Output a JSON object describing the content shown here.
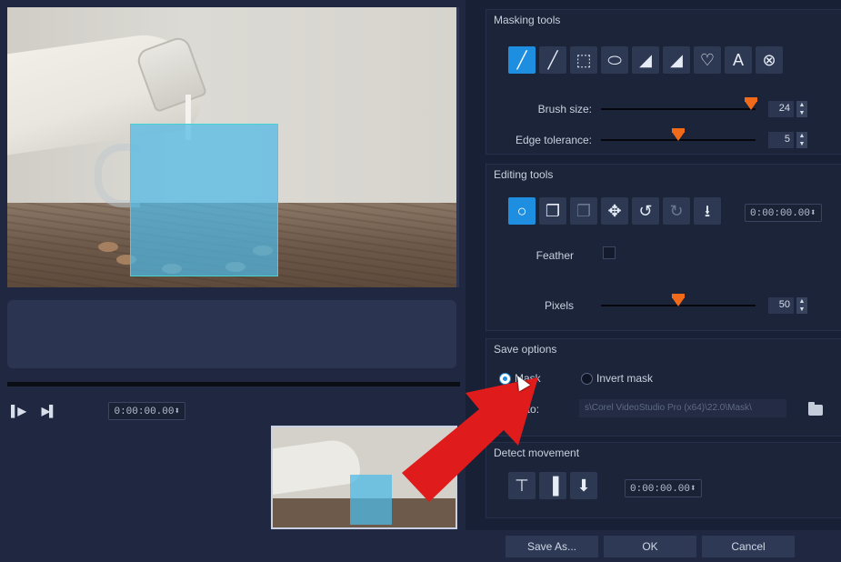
{
  "masking_tools": {
    "title": "Masking tools",
    "tools": [
      {
        "name": "brush-tool-icon",
        "glyph": "╱",
        "active": true
      },
      {
        "name": "smart-brush-icon",
        "glyph": "╱",
        "active": false
      },
      {
        "name": "rectangle-select-icon",
        "glyph": "⬚",
        "active": false
      },
      {
        "name": "ellipse-select-icon",
        "glyph": "⬭",
        "active": false
      },
      {
        "name": "eraser-icon",
        "glyph": "◢",
        "active": false
      },
      {
        "name": "smart-eraser-icon",
        "glyph": "◢",
        "active": false
      },
      {
        "name": "lasso-icon",
        "glyph": "♡",
        "active": false
      },
      {
        "name": "text-tool-icon",
        "glyph": "A",
        "active": false
      },
      {
        "name": "clear-mask-icon",
        "glyph": "⊗",
        "active": false
      }
    ],
    "brush_size_label": "Brush size:",
    "brush_size_value": "24",
    "brush_size_fraction": 0.97,
    "edge_tolerance_label": "Edge tolerance:",
    "edge_tolerance_value": "5",
    "edge_tolerance_fraction": 0.5
  },
  "editing_tools": {
    "title": "Editing tools",
    "tools": [
      {
        "name": "track-motion-icon",
        "glyph": "○",
        "active": true,
        "dim": false
      },
      {
        "name": "copy-mask-icon",
        "glyph": "❐",
        "active": false,
        "dim": false
      },
      {
        "name": "paste-mask-icon",
        "glyph": "❐",
        "active": false,
        "dim": true
      },
      {
        "name": "move-icon",
        "glyph": "✥",
        "active": false,
        "dim": false
      },
      {
        "name": "undo-icon",
        "glyph": "↺",
        "active": false,
        "dim": false
      },
      {
        "name": "redo-icon",
        "glyph": "↻",
        "active": false,
        "dim": true
      },
      {
        "name": "export-icon",
        "glyph": "⭳",
        "active": false,
        "dim": false
      }
    ],
    "timecode": "0:00:00.00⬍",
    "feather_label": "Feather",
    "pixels_label": "Pixels",
    "pixels_value": "50",
    "pixels_fraction": 0.5
  },
  "save_options": {
    "title": "Save options",
    "mask_label": "Mask",
    "invert_mask_label": "Invert mask",
    "save_to_label": "Save to:",
    "save_to_path": "s\\Corel VideoStudio Pro (x64)\\22.0\\Mask\\"
  },
  "detect_movement": {
    "title": "Detect movement",
    "tools": [
      {
        "name": "detect-frame-icon",
        "glyph": "⊤"
      },
      {
        "name": "detect-next-icon",
        "glyph": "▐"
      },
      {
        "name": "detect-range-icon",
        "glyph": "⬇"
      }
    ],
    "timecode": "0:00:00.00⬍"
  },
  "player": {
    "timecode": "0:00:00.00⬍",
    "next_frame_icon": "▌▶",
    "end_icon": "▶▌"
  },
  "buttons": {
    "save_as": "Save As...",
    "ok": "OK",
    "cancel": "Cancel"
  },
  "colors": {
    "accent": "#1e8fe0",
    "slider_thumb": "#f06a1a",
    "mask_overlay": "#4fb9e6",
    "arrow": "#e01b1b"
  }
}
